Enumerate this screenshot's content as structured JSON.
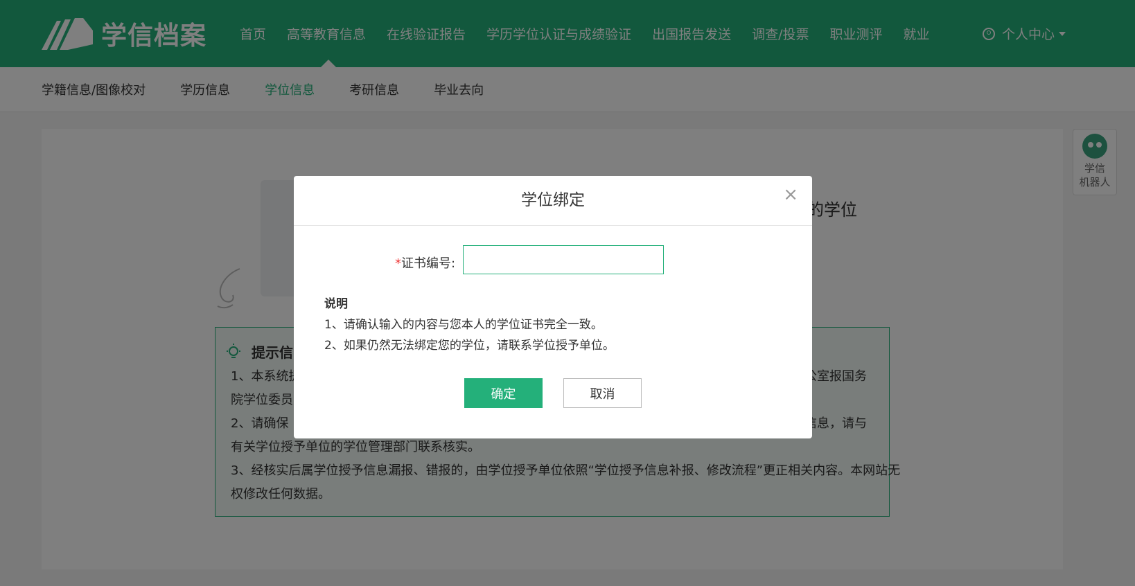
{
  "header": {
    "logo_text": "学信档案",
    "nav": [
      "首页",
      "高等教育信息",
      "在线验证报告",
      "学历学位认证与成绩验证",
      "出国报告发送",
      "调查/投票",
      "职业测评",
      "就业"
    ],
    "user_center": "个人中心"
  },
  "subnav": {
    "items": [
      "学籍信息/图像校对",
      "学历信息",
      "学位信息",
      "考研信息",
      "毕业去向"
    ],
    "active": "学位信息"
  },
  "background": {
    "title_fragment": "的学位",
    "tips": {
      "title": "提示信",
      "line1": "1、本系统提",
      "line1_end": "公室报国务",
      "line2": "院学位委员",
      "line3": "2、请确保",
      "line3_end": "信息，请与",
      "line4": "有关学位授予单位的学位管理部门联系核实。",
      "line5": "3、经核实后属学位授予信息漏报、错报的，由学位授予单位依照“学位授予信息补报、修改流程”更正相关内容。本网站无",
      "line6": "权修改任何数据。"
    },
    "robot": {
      "line1": "学信",
      "line2": "机器人"
    }
  },
  "modal": {
    "title": "学位绑定",
    "close": "×",
    "required_mark": "*",
    "field_label": "证书编号:",
    "field_value": "",
    "notes_title": "说明",
    "note1": "1、请确认输入的内容与您本人的学位证书完全一致。",
    "note2": "2、如果仍然无法绑定您的学位，请联系学位授予单位。",
    "confirm": "确定",
    "cancel": "取消"
  },
  "colors": {
    "brand": "#24b07a",
    "overlay": "rgba(0,0,0,0.5)",
    "required": "#e33"
  }
}
